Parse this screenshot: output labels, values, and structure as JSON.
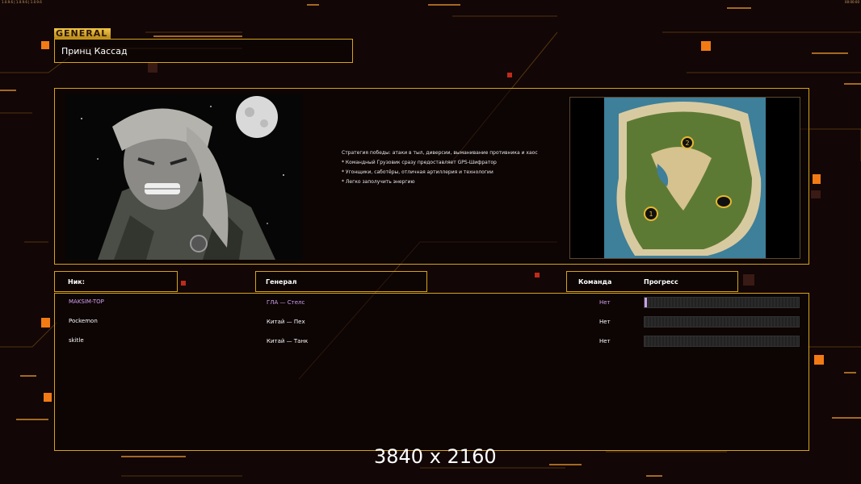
{
  "topbar": {
    "left_text": "1.0.9.6 | 1.0.9.6 | 1.0.9.6",
    "right_text": "00:00:00"
  },
  "header": {
    "tag": "GENERAL",
    "general_name": "Принц Кассад"
  },
  "description": {
    "lines": [
      "Стратегия победы: атаки в тыл, диверсии, выманивание противника и хаос",
      "* Командный Грузовик сразу предоставляет GPS-Шифратор",
      "* Угонщики, саботёры, отличная артиллерия и технологии",
      "* Легко заполучить энергию"
    ]
  },
  "columns": {
    "nick": "Ник:",
    "general": "Генерал",
    "team": "Команда",
    "progress": "Прогресс"
  },
  "players": [
    {
      "nick": "MAKSIM-TOP",
      "general": "ГЛА — Стелс",
      "team": "Нет",
      "progress": 0.01,
      "color": "#d2a0ef"
    },
    {
      "nick": "Pockemon",
      "general": "Китай — Пех",
      "team": "Нет",
      "progress": 0,
      "color": "#ffffff"
    },
    {
      "nick": "skitle",
      "general": "Китай — Танк",
      "team": "Нет",
      "progress": 0,
      "color": "#ffffff"
    }
  ],
  "map": {
    "start_positions": [
      "1",
      "2"
    ]
  },
  "watermark": "3840 x 2160",
  "colors": {
    "accent": "#d7a317",
    "background": "#120606",
    "highlight_player": "#d2a0ef"
  },
  "icons": [
    "portrait-image",
    "map-thumbnail"
  ]
}
